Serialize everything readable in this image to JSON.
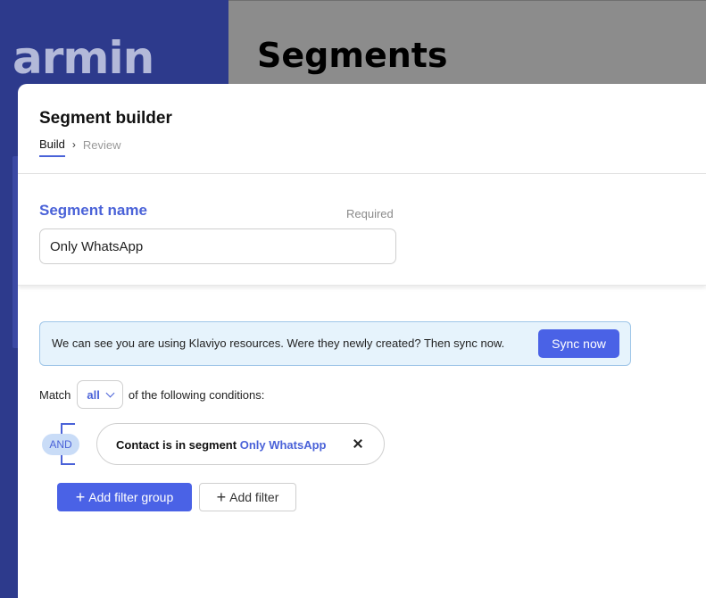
{
  "background": {
    "logo_text": "armin",
    "page_title": "Segments"
  },
  "modal": {
    "title": "Segment builder",
    "breadcrumb": {
      "build": "Build",
      "separator": "›",
      "review": "Review"
    }
  },
  "segment_name": {
    "label": "Segment name",
    "required_text": "Required",
    "value": "Only WhatsApp"
  },
  "banner": {
    "text": "We can see you are using Klaviyo resources. Were they newly created? Then sync now.",
    "button_label": "Sync now"
  },
  "match": {
    "prefix": "Match",
    "selected": "all",
    "suffix": "of the following conditions:"
  },
  "conditions": {
    "operator": "AND",
    "items": [
      {
        "text": "Contact is in segment",
        "value": "Only WhatsApp"
      }
    ]
  },
  "actions": {
    "add_group_label": "Add filter group",
    "add_filter_label": "Add filter",
    "plus_glyph": "+"
  },
  "colors": {
    "accent": "#4a62e6",
    "sidebar": "#2d3a8c",
    "banner_bg": "#e6f3fc"
  }
}
